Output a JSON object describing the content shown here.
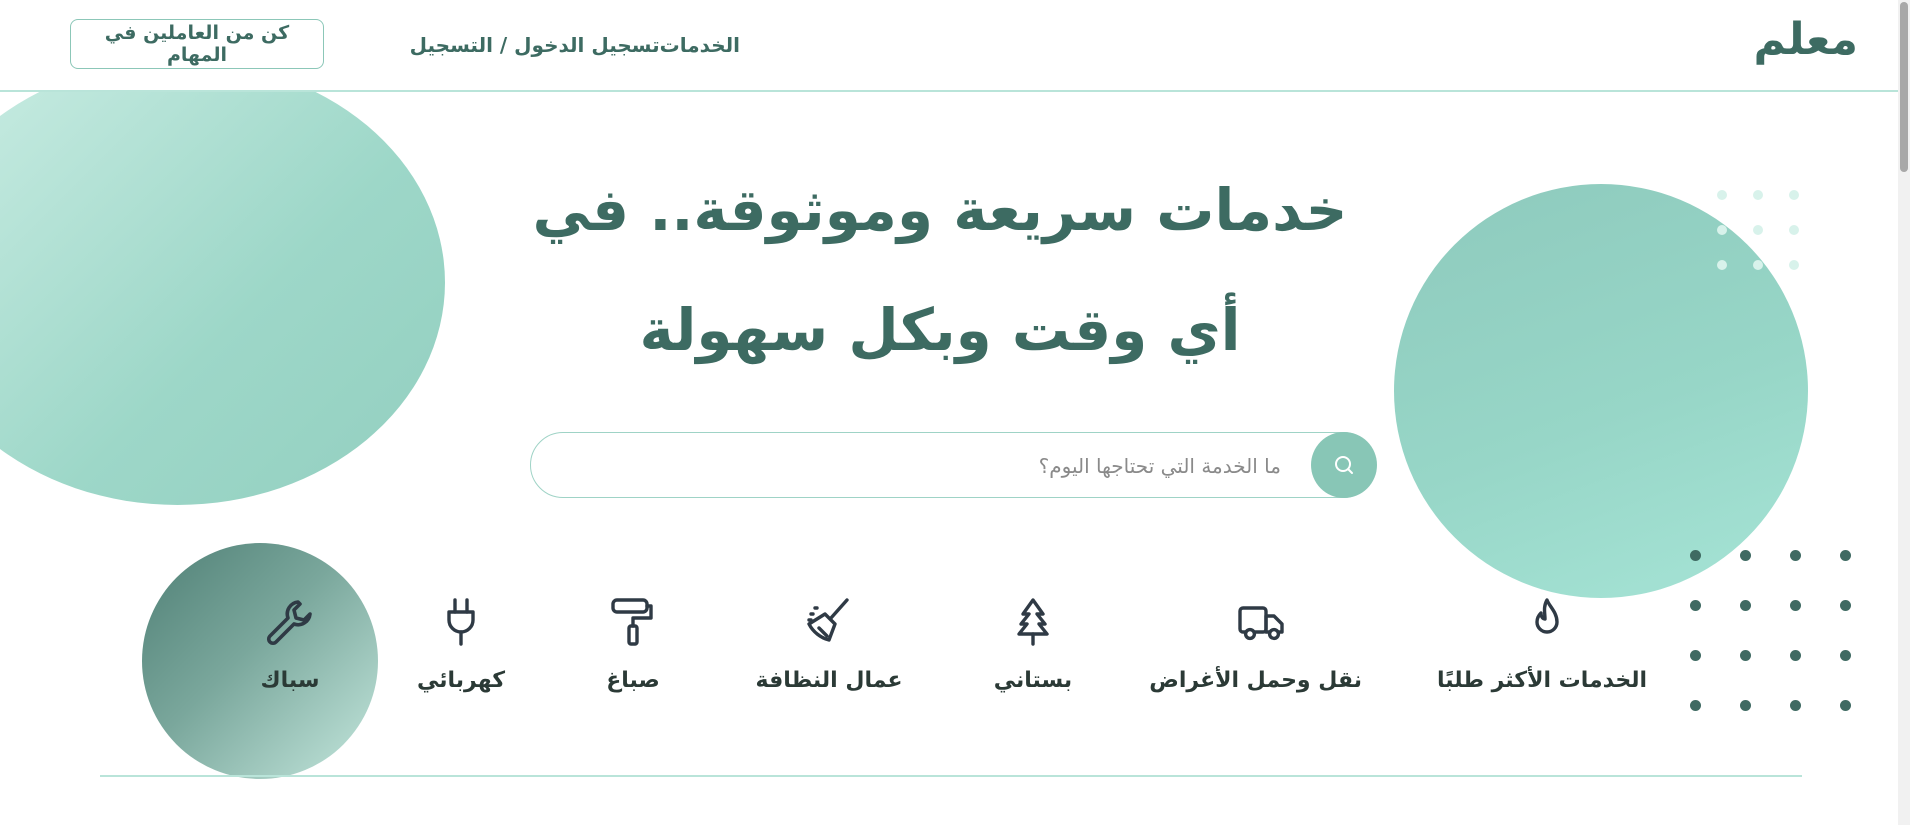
{
  "header": {
    "logo": "معلم",
    "nav": {
      "services": "الخدمات",
      "login": "تسجيل الدخول / التسجيل"
    },
    "join_button": "كن من العاملين في المهام"
  },
  "hero": {
    "title_line1": "خدمات سريعة وموثوقة.. في",
    "title_line2": "أي وقت وبكل سهولة"
  },
  "search": {
    "placeholder": "ما الخدمة التي تحتاجها اليوم؟",
    "value": ""
  },
  "categories": [
    {
      "label": "الخدمات الأكثر طلبًا",
      "icon": "fire-icon"
    },
    {
      "label": "نقل وحمل الأغراض",
      "icon": "truck-icon"
    },
    {
      "label": "بستاني",
      "icon": "tree-icon"
    },
    {
      "label": "عمال النظافة",
      "icon": "broom-icon"
    },
    {
      "label": "صباغ",
      "icon": "paint-roller-icon"
    },
    {
      "label": "كهربائي",
      "icon": "plug-icon"
    },
    {
      "label": "سباك",
      "icon": "wrench-icon"
    }
  ],
  "colors": {
    "primary": "#3d6b62",
    "accent": "#88c6b6",
    "light_accent": "#b9e4d9",
    "text_dark": "#2b3a36"
  }
}
